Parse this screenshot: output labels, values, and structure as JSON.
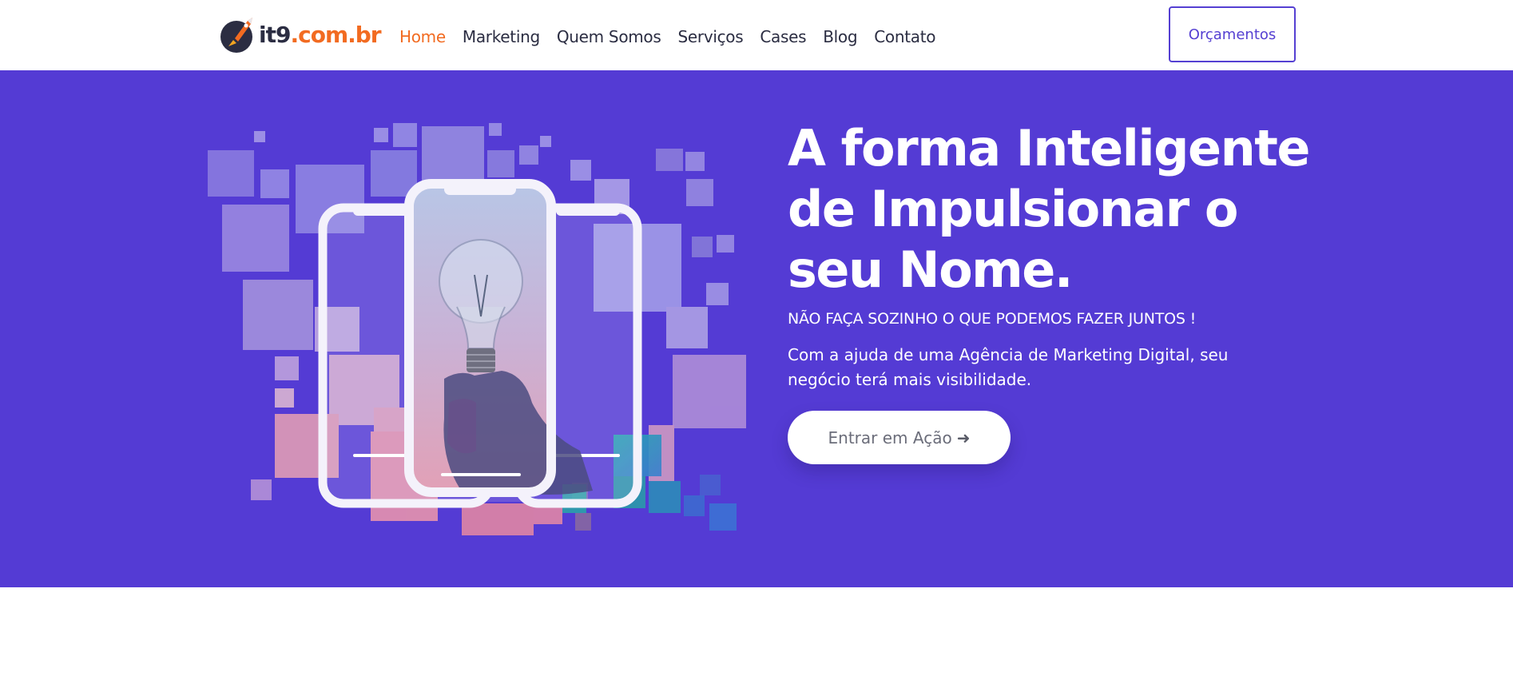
{
  "brand": {
    "logo_main": "it9",
    "logo_domain": ".com.br",
    "accent_color": "#f26b21",
    "primary_color": "#543bd4"
  },
  "nav": {
    "items": [
      {
        "label": "Home",
        "active": true
      },
      {
        "label": "Marketing",
        "active": false
      },
      {
        "label": "Quem Somos",
        "active": false
      },
      {
        "label": "Serviços",
        "active": false
      },
      {
        "label": "Cases",
        "active": false
      },
      {
        "label": "Blog",
        "active": false
      },
      {
        "label": "Contato",
        "active": false
      }
    ],
    "cta_label": "Orçamentos"
  },
  "hero": {
    "title_line1": "A forma Inteligente",
    "title_line2": "de Impulsionar o",
    "title_line3": "seu Nome.",
    "subtitle": "NÃO FAÇA SOZINHO O QUE PODEMOS FAZER JUNTOS !",
    "description": "Com a ajuda de uma Agência de Marketing Digital, seu negócio terá mais visibilidade.",
    "cta_label": "Entrar em Ação",
    "cta_icon": "arrow-right-icon",
    "illustration": "phones-lightbulb-illustration"
  }
}
